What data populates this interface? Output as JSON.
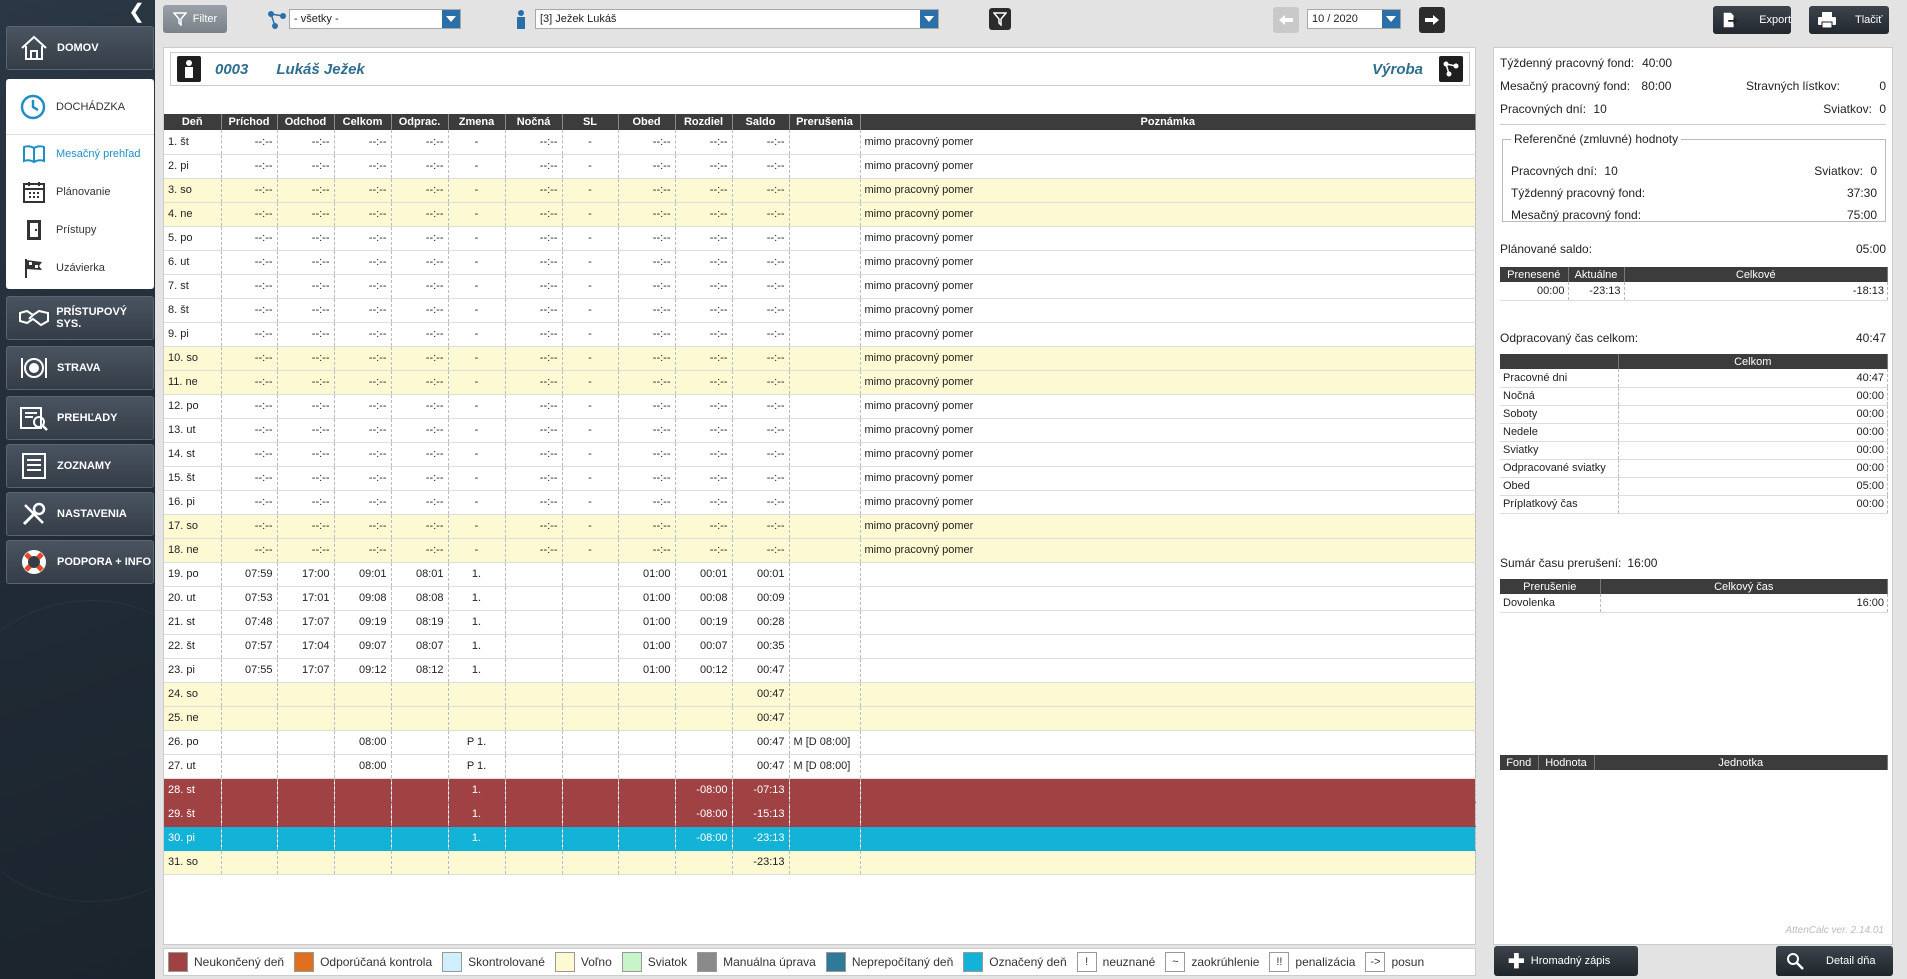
{
  "sidebar": {
    "items": [
      {
        "label": "DOMOV",
        "icon": "house-icon"
      },
      {
        "label": "PRÍSTUPOVÝ SYS.",
        "icon": "handshake-icon"
      },
      {
        "label": "STRAVA",
        "icon": "plate-icon"
      },
      {
        "label": "PREHĽADY",
        "icon": "report-icon"
      },
      {
        "label": "ZOZNAMY",
        "icon": "list-icon"
      },
      {
        "label": "NASTAVENIA",
        "icon": "tools-icon"
      },
      {
        "label": "PODPORA + INFO",
        "icon": "lifebuoy-icon"
      }
    ],
    "dochadzka": {
      "label": "DOCHÁDZKA",
      "subitems": [
        {
          "label": "Mesačný prehľad",
          "icon": "book-icon"
        },
        {
          "label": "Plánovanie",
          "icon": "calendar-icon"
        },
        {
          "label": "Prístupy",
          "icon": "door-icon"
        },
        {
          "label": "Uzávierka",
          "icon": "flag-icon"
        }
      ]
    }
  },
  "toolbar": {
    "filter_label": "Filter",
    "group_select": "- všetky -",
    "employee_select": "[3] Ježek Lukáš",
    "period": "10 / 2020",
    "export_label": "Export",
    "print_label": "Tlačiť"
  },
  "employee": {
    "number": "0003",
    "name": "Lukáš Ježek",
    "department": "Výroba"
  },
  "table": {
    "columns": [
      "Deň",
      "Príchod",
      "Odchod",
      "Celkom",
      "Odprac.",
      "Zmena",
      "Nočná",
      "SL",
      "Obed",
      "Rozdiel",
      "Saldo",
      "Prerušenia",
      "Poznámka"
    ],
    "rows": [
      {
        "t": "w",
        "c": [
          "1. št",
          "--:--",
          "--:--",
          "--:--",
          "--:--",
          "-",
          "--:--",
          "-",
          "--:--",
          "--:--",
          "--:--",
          "",
          "mimo pracovný pomer"
        ]
      },
      {
        "t": "w",
        "c": [
          "2. pi",
          "--:--",
          "--:--",
          "--:--",
          "--:--",
          "-",
          "--:--",
          "-",
          "--:--",
          "--:--",
          "--:--",
          "",
          "mimo pracovný pomer"
        ]
      },
      {
        "t": "y",
        "c": [
          "3. so",
          "--:--",
          "--:--",
          "--:--",
          "--:--",
          "-",
          "--:--",
          "-",
          "--:--",
          "--:--",
          "--:--",
          "",
          "mimo pracovný pomer"
        ]
      },
      {
        "t": "y",
        "c": [
          "4. ne",
          "--:--",
          "--:--",
          "--:--",
          "--:--",
          "-",
          "--:--",
          "-",
          "--:--",
          "--:--",
          "--:--",
          "",
          "mimo pracovný pomer"
        ]
      },
      {
        "t": "w",
        "c": [
          "5. po",
          "--:--",
          "--:--",
          "--:--",
          "--:--",
          "-",
          "--:--",
          "-",
          "--:--",
          "--:--",
          "--:--",
          "",
          "mimo pracovný pomer"
        ]
      },
      {
        "t": "w",
        "c": [
          "6. ut",
          "--:--",
          "--:--",
          "--:--",
          "--:--",
          "-",
          "--:--",
          "-",
          "--:--",
          "--:--",
          "--:--",
          "",
          "mimo pracovný pomer"
        ]
      },
      {
        "t": "w",
        "c": [
          "7. st",
          "--:--",
          "--:--",
          "--:--",
          "--:--",
          "-",
          "--:--",
          "-",
          "--:--",
          "--:--",
          "--:--",
          "",
          "mimo pracovný pomer"
        ]
      },
      {
        "t": "w",
        "c": [
          "8. št",
          "--:--",
          "--:--",
          "--:--",
          "--:--",
          "-",
          "--:--",
          "-",
          "--:--",
          "--:--",
          "--:--",
          "",
          "mimo pracovný pomer"
        ]
      },
      {
        "t": "w",
        "c": [
          "9. pi",
          "--:--",
          "--:--",
          "--:--",
          "--:--",
          "-",
          "--:--",
          "-",
          "--:--",
          "--:--",
          "--:--",
          "",
          "mimo pracovný pomer"
        ]
      },
      {
        "t": "y",
        "c": [
          "10. so",
          "--:--",
          "--:--",
          "--:--",
          "--:--",
          "-",
          "--:--",
          "-",
          "--:--",
          "--:--",
          "--:--",
          "",
          "mimo pracovný pomer"
        ]
      },
      {
        "t": "y",
        "c": [
          "11. ne",
          "--:--",
          "--:--",
          "--:--",
          "--:--",
          "-",
          "--:--",
          "-",
          "--:--",
          "--:--",
          "--:--",
          "",
          "mimo pracovný pomer"
        ]
      },
      {
        "t": "w",
        "c": [
          "12. po",
          "--:--",
          "--:--",
          "--:--",
          "--:--",
          "-",
          "--:--",
          "-",
          "--:--",
          "--:--",
          "--:--",
          "",
          "mimo pracovný pomer"
        ]
      },
      {
        "t": "w",
        "c": [
          "13. ut",
          "--:--",
          "--:--",
          "--:--",
          "--:--",
          "-",
          "--:--",
          "-",
          "--:--",
          "--:--",
          "--:--",
          "",
          "mimo pracovný pomer"
        ]
      },
      {
        "t": "w",
        "c": [
          "14. st",
          "--:--",
          "--:--",
          "--:--",
          "--:--",
          "-",
          "--:--",
          "-",
          "--:--",
          "--:--",
          "--:--",
          "",
          "mimo pracovný pomer"
        ]
      },
      {
        "t": "w",
        "c": [
          "15. št",
          "--:--",
          "--:--",
          "--:--",
          "--:--",
          "-",
          "--:--",
          "-",
          "--:--",
          "--:--",
          "--:--",
          "",
          "mimo pracovný pomer"
        ]
      },
      {
        "t": "w",
        "c": [
          "16. pi",
          "--:--",
          "--:--",
          "--:--",
          "--:--",
          "-",
          "--:--",
          "-",
          "--:--",
          "--:--",
          "--:--",
          "",
          "mimo pracovný pomer"
        ]
      },
      {
        "t": "y",
        "c": [
          "17. so",
          "--:--",
          "--:--",
          "--:--",
          "--:--",
          "-",
          "--:--",
          "-",
          "--:--",
          "--:--",
          "--:--",
          "",
          "mimo pracovný pomer"
        ]
      },
      {
        "t": "y",
        "c": [
          "18. ne",
          "--:--",
          "--:--",
          "--:--",
          "--:--",
          "-",
          "--:--",
          "-",
          "--:--",
          "--:--",
          "--:--",
          "",
          "mimo pracovný pomer"
        ]
      },
      {
        "t": "w",
        "c": [
          "19. po",
          "07:59",
          "17:00",
          "09:01",
          "08:01",
          "1.",
          "",
          "",
          "01:00",
          "00:01",
          "00:01",
          "",
          ""
        ]
      },
      {
        "t": "w",
        "c": [
          "20. ut",
          "07:53",
          "17:01",
          "09:08",
          "08:08",
          "1.",
          "",
          "",
          "01:00",
          "00:08",
          "00:09",
          "",
          ""
        ]
      },
      {
        "t": "w",
        "c": [
          "21. st",
          "07:48",
          "17:07",
          "09:19",
          "08:19",
          "1.",
          "",
          "",
          "01:00",
          "00:19",
          "00:28",
          "",
          ""
        ]
      },
      {
        "t": "w",
        "c": [
          "22. št",
          "07:57",
          "17:04",
          "09:07",
          "08:07",
          "1.",
          "",
          "",
          "01:00",
          "00:07",
          "00:35",
          "",
          ""
        ]
      },
      {
        "t": "w",
        "c": [
          "23. pi",
          "07:55",
          "17:07",
          "09:12",
          "08:12",
          "1.",
          "",
          "",
          "01:00",
          "00:12",
          "00:47",
          "",
          ""
        ]
      },
      {
        "t": "y",
        "c": [
          "24. so",
          "",
          "",
          "",
          "",
          "",
          "",
          "",
          "",
          "",
          "00:47",
          "",
          ""
        ]
      },
      {
        "t": "y",
        "c": [
          "25. ne",
          "",
          "",
          "",
          "",
          "",
          "",
          "",
          "",
          "",
          "00:47",
          "",
          ""
        ]
      },
      {
        "t": "w",
        "c": [
          "26. po",
          "",
          "",
          "08:00",
          "",
          "P 1.",
          "",
          "",
          "",
          "",
          "00:47",
          "M [D 08:00]",
          ""
        ]
      },
      {
        "t": "w",
        "c": [
          "27. ut",
          "",
          "",
          "08:00",
          "",
          "P 1.",
          "",
          "",
          "",
          "",
          "00:47",
          "M [D 08:00]",
          ""
        ]
      },
      {
        "t": "r",
        "c": [
          "28. st",
          "",
          "",
          "",
          "",
          "1.",
          "",
          "",
          "",
          "-08:00",
          "-07:13",
          "",
          ""
        ]
      },
      {
        "t": "r",
        "c": [
          "29. št",
          "",
          "",
          "",
          "",
          "1.",
          "",
          "",
          "",
          "-08:00",
          "-15:13",
          "",
          ""
        ]
      },
      {
        "t": "b",
        "c": [
          "30. pi",
          "",
          "",
          "",
          "",
          "1.",
          "",
          "",
          "",
          "-08:00",
          "-23:13",
          "",
          ""
        ]
      },
      {
        "t": "y",
        "c": [
          "31. so",
          "",
          "",
          "",
          "",
          "",
          "",
          "",
          "",
          "",
          "-23:13",
          "",
          ""
        ]
      }
    ]
  },
  "legend": [
    {
      "label": "Neukončený deň",
      "color": "#a04244"
    },
    {
      "label": "Odporúčaná kontrola",
      "color": "#e07020"
    },
    {
      "label": "Skontrolované",
      "color": "#cfefff"
    },
    {
      "label": "Voľno",
      "color": "#fdfad3"
    },
    {
      "label": "Sviatok",
      "color": "#c8f5c8"
    },
    {
      "label": "Manuálna úprava",
      "color": "#8a8a8a"
    },
    {
      "label": "Neprepočítaný deň",
      "color": "#2f7a98"
    },
    {
      "label": "Označený deň",
      "color": "#12b3d6"
    }
  ],
  "legend_symbols": [
    {
      "sym": "!",
      "label": "neuznané"
    },
    {
      "sym": "~",
      "label": "zaokrúhlenie"
    },
    {
      "sym": "!!",
      "label": "penalizácia"
    },
    {
      "sym": "->",
      "label": "posun"
    }
  ],
  "summary": {
    "weekly_fund_label": "Týždenný pracovný fond:",
    "weekly_fund": "40:00",
    "monthly_fund_label": "Mesačný pracovný fond:",
    "monthly_fund": "80:00",
    "meal_label": "Stravných lístkov:",
    "meal": "0",
    "workdays_label": "Pracovných dní:",
    "workdays": "10",
    "holidays_label": "Sviatkov:",
    "holidays": "0",
    "ref_title": "Referenčné (zmluvné) hodnoty",
    "ref_workdays_label": "Pracovných dní:",
    "ref_workdays": "10",
    "ref_holidays_label": "Sviatkov:",
    "ref_holidays": "0",
    "ref_weekly_label": "Týždenný pracovný fond:",
    "ref_weekly": "37:30",
    "ref_monthly_label": "Mesačný pracovný fond:",
    "ref_monthly": "75:00",
    "planned_label": "Plánované saldo:",
    "planned": "05:00",
    "saldo_headers": [
      "Prenesené",
      "Aktuálne",
      "Celkové"
    ],
    "saldo_values": [
      "00:00",
      "-23:13",
      "-18:13"
    ],
    "worked_label": "Odpracovaný čas celkom:",
    "worked": "40:47",
    "worked_header": "Celkom",
    "worked_rows": [
      {
        "k": "Pracovné dni",
        "v": "40:47"
      },
      {
        "k": "Nočná",
        "v": "00:00"
      },
      {
        "k": "Soboty",
        "v": "00:00"
      },
      {
        "k": "Nedele",
        "v": "00:00"
      },
      {
        "k": "Sviatky",
        "v": "00:00"
      },
      {
        "k": "Odpracované sviatky",
        "v": "00:00"
      },
      {
        "k": "Obed",
        "v": "05:00"
      },
      {
        "k": "Príplatkový čas",
        "v": "00:00"
      }
    ],
    "interrupt_label": "Sumár času prerušení:",
    "interrupt": "16:00",
    "interrupt_headers": [
      "Prerušenie",
      "Celkový čas"
    ],
    "interrupt_rows": [
      {
        "k": "Dovolenka",
        "v": "16:00"
      }
    ],
    "fund_headers": [
      "Fond",
      "Hodnota",
      "Jednotka"
    ],
    "version": "AttenCalc ver. 2.14.01"
  },
  "bottom": {
    "bulk_label": "Hromadný zápis",
    "detail_label": "Detail dňa"
  }
}
